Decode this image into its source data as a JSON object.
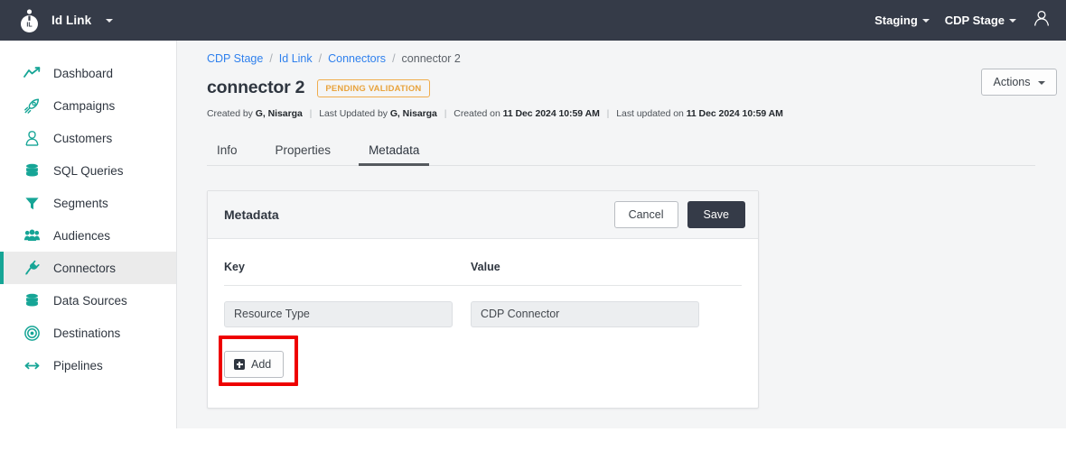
{
  "topbar": {
    "logo_icon": "id-link-logo-icon",
    "brand": "Id Link",
    "environment": "Staging",
    "workspace": "CDP Stage",
    "avatar_icon": "user-avatar-icon",
    "background": "#353b48"
  },
  "sidebar": {
    "items": [
      {
        "label": "Dashboard",
        "icon": "chart-line-icon",
        "active": false
      },
      {
        "label": "Campaigns",
        "icon": "rocket-icon",
        "active": false
      },
      {
        "label": "Customers",
        "icon": "user-icon",
        "active": false
      },
      {
        "label": "SQL Queries",
        "icon": "database-icon",
        "active": false
      },
      {
        "label": "Segments",
        "icon": "filter-icon",
        "active": false
      },
      {
        "label": "Audiences",
        "icon": "users-group-icon",
        "active": false
      },
      {
        "label": "Connectors",
        "icon": "plug-icon",
        "active": true
      },
      {
        "label": "Data Sources",
        "icon": "database-icon",
        "active": false
      },
      {
        "label": "Destinations",
        "icon": "target-icon",
        "active": false
      },
      {
        "label": "Pipelines",
        "icon": "arrows-icon",
        "active": false
      }
    ],
    "accent": "#16a596",
    "active_background": "#ebebeb"
  },
  "breadcrumb": {
    "items": [
      "CDP Stage",
      "Id Link",
      "Connectors"
    ],
    "separator": "/",
    "current": "connector 2",
    "link_color": "#2f80ed"
  },
  "header": {
    "title": "connector 2",
    "status_badge": "PENDING VALIDATION",
    "status_color": "#e8a33d",
    "actions_label": "Actions",
    "audit": {
      "created_by_label": "Created by",
      "created_by_value": "G, Nisarga",
      "last_updated_by_label": "Last Updated by",
      "last_updated_by_value": "G, Nisarga",
      "created_on_label": "Created on",
      "created_on_value": "11 Dec 2024 10:59 AM",
      "last_updated_on_label": "Last updated on",
      "last_updated_on_value": "11 Dec 2024 10:59 AM",
      "separator": "|"
    }
  },
  "tabs": [
    {
      "label": "Info",
      "active": false
    },
    {
      "label": "Properties",
      "active": false
    },
    {
      "label": "Metadata",
      "active": true
    }
  ],
  "card": {
    "title": "Metadata",
    "cancel_label": "Cancel",
    "save_label": "Save",
    "columns": {
      "key": "Key",
      "value": "Value"
    },
    "rows": [
      {
        "key": "Resource Type",
        "value": "CDP Connector"
      }
    ],
    "add_label": "Add",
    "add_icon": "plus-square-icon"
  },
  "annotation": {
    "highlight_target": "add-button",
    "color": "#ee0000"
  }
}
